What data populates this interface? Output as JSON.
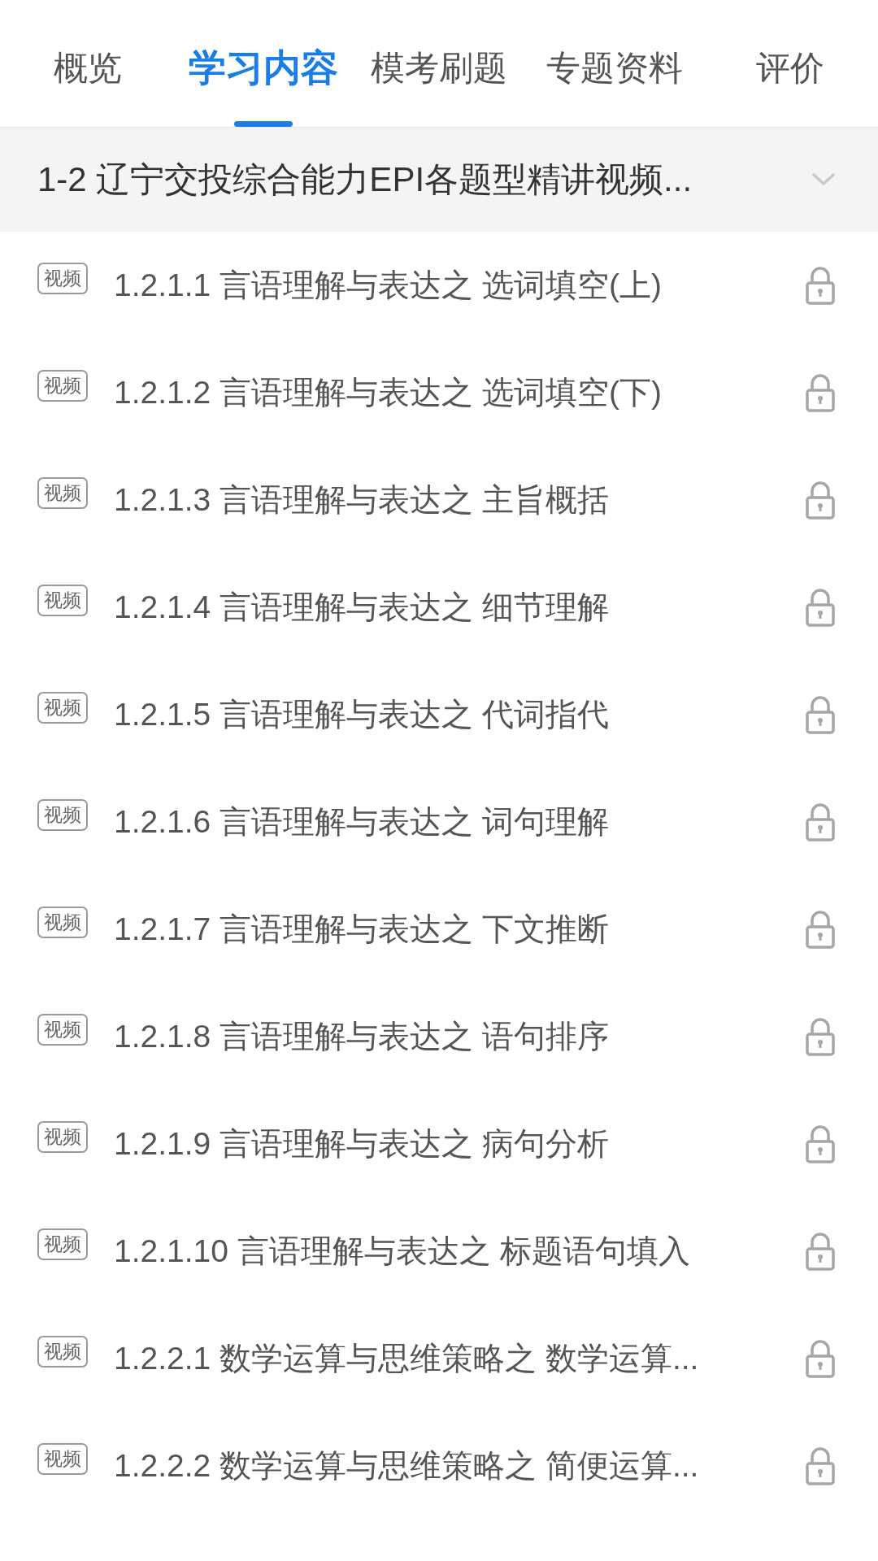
{
  "tabs": [
    {
      "label": "概览",
      "selected": false
    },
    {
      "label": "学习内容",
      "selected": true
    },
    {
      "label": "模考刷题",
      "selected": false
    },
    {
      "label": "专题资料",
      "selected": false
    },
    {
      "label": "评价",
      "selected": false
    }
  ],
  "chapter": {
    "title": "1-2 辽宁交投综合能力EPI各题型精讲视频...",
    "expanded": false
  },
  "lessons": [
    {
      "badge": "视频",
      "title": "1.2.1.1 言语理解与表达之 选词填空(上)",
      "locked": true
    },
    {
      "badge": "视频",
      "title": "1.2.1.2 言语理解与表达之 选词填空(下)",
      "locked": true
    },
    {
      "badge": "视频",
      "title": "1.2.1.3 言语理解与表达之 主旨概括",
      "locked": true
    },
    {
      "badge": "视频",
      "title": "1.2.1.4 言语理解与表达之 细节理解",
      "locked": true
    },
    {
      "badge": "视频",
      "title": "1.2.1.5 言语理解与表达之 代词指代",
      "locked": true
    },
    {
      "badge": "视频",
      "title": "1.2.1.6 言语理解与表达之 词句理解",
      "locked": true
    },
    {
      "badge": "视频",
      "title": "1.2.1.7 言语理解与表达之 下文推断",
      "locked": true
    },
    {
      "badge": "视频",
      "title": "1.2.1.8 言语理解与表达之 语句排序",
      "locked": true
    },
    {
      "badge": "视频",
      "title": "1.2.1.9 言语理解与表达之 病句分析",
      "locked": true
    },
    {
      "badge": "视频",
      "title": "1.2.1.10 言语理解与表达之 标题语句填入",
      "locked": true
    },
    {
      "badge": "视频",
      "title": "1.2.2.1 数学运算与思维策略之 数学运算...",
      "locked": true
    },
    {
      "badge": "视频",
      "title": "1.2.2.2 数学运算与思维策略之 简便运算...",
      "locked": true
    }
  ]
}
